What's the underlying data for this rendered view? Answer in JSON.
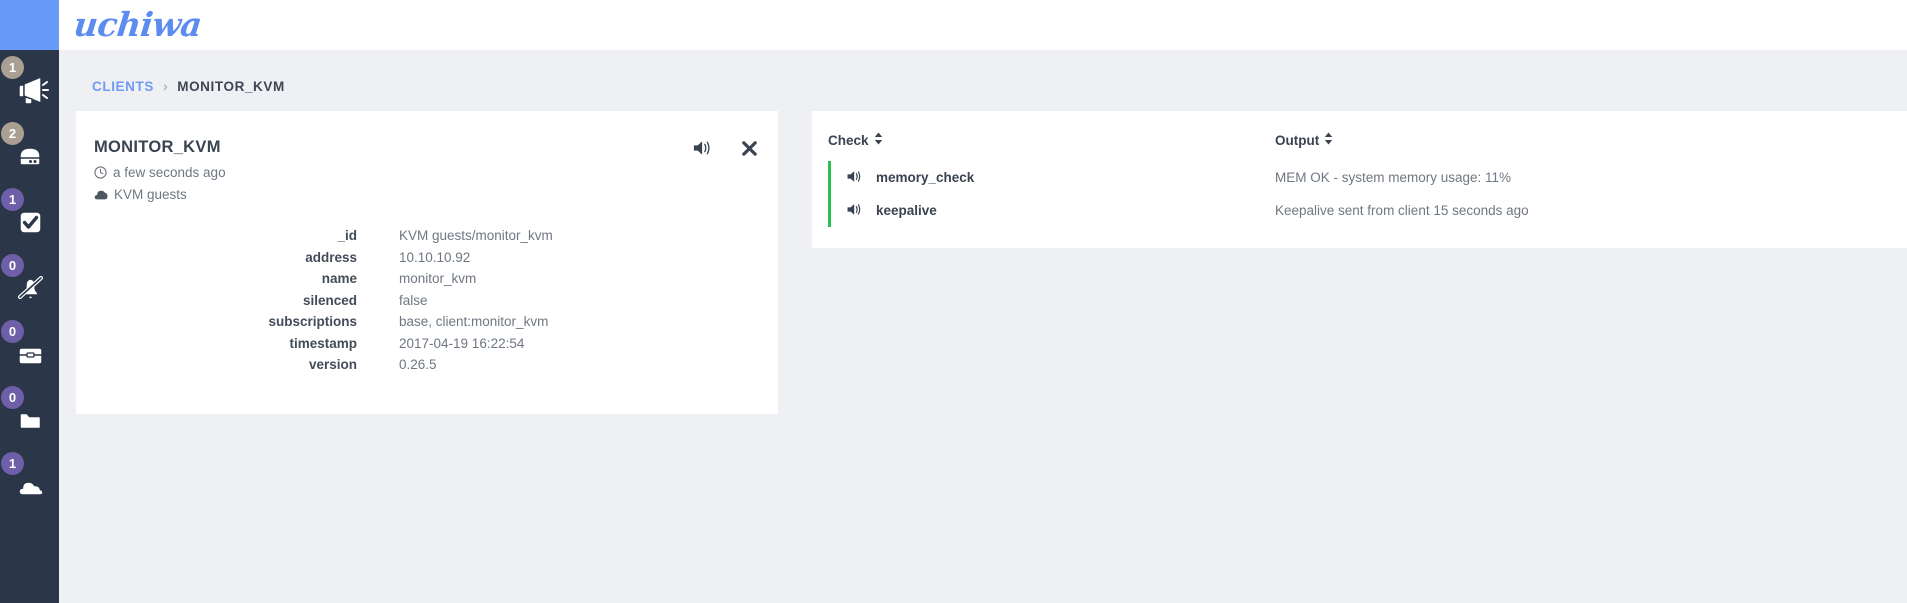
{
  "brand": {
    "logo_text": "uchiwa",
    "logo_color": "#5c8cf0",
    "sidebar_color": "#2b3648"
  },
  "sidebar": {
    "items": [
      {
        "label": "events",
        "icon": "megaphone-icon",
        "badge": "1",
        "badge_color": "#a9a093"
      },
      {
        "label": "clients",
        "icon": "server-icon",
        "badge": "2",
        "badge_color": "#a9a093"
      },
      {
        "label": "checks",
        "icon": "check-square-icon",
        "badge": "1",
        "badge_color": "#6f5fa8"
      },
      {
        "label": "silenced",
        "icon": "bell-slash-icon",
        "badge": "0",
        "badge_color": "#6f5fa8"
      },
      {
        "label": "aggregates",
        "icon": "briefcase-icon",
        "badge": "0",
        "badge_color": "#6f5fa8"
      },
      {
        "label": "stashes",
        "icon": "folder-icon",
        "badge": "0",
        "badge_color": "#6f5fa8"
      },
      {
        "label": "datacenters",
        "icon": "cloud-icon",
        "badge": "1",
        "badge_color": "#6f5fa8"
      }
    ]
  },
  "breadcrumb": {
    "parent": "CLIENTS",
    "separator": "›",
    "current": "MONITOR_KVM"
  },
  "detail_card": {
    "title": "MONITOR_KVM",
    "time_ago": "a few seconds ago",
    "datacenter": "KVM guests",
    "actions": {
      "silence_label": "silence",
      "close_label": "close"
    },
    "rows": [
      {
        "key": "_id",
        "value": "KVM guests/monitor_kvm"
      },
      {
        "key": "address",
        "value": "10.10.10.92"
      },
      {
        "key": "name",
        "value": "monitor_kvm"
      },
      {
        "key": "silenced",
        "value": "false"
      },
      {
        "key": "subscriptions",
        "value": "base, client:monitor_kvm"
      },
      {
        "key": "timestamp",
        "value": "2017-04-19 16:22:54"
      },
      {
        "key": "version",
        "value": "0.26.5"
      }
    ]
  },
  "checks_panel": {
    "columns": {
      "check": "Check",
      "output": "Output"
    },
    "status_ok_color": "#2bbd4e",
    "rows": [
      {
        "name": "memory_check",
        "output": "MEM OK - system memory usage: 11%",
        "status": "ok"
      },
      {
        "name": "keepalive",
        "output": "Keepalive sent from client 15 seconds ago",
        "status": "ok"
      }
    ]
  }
}
